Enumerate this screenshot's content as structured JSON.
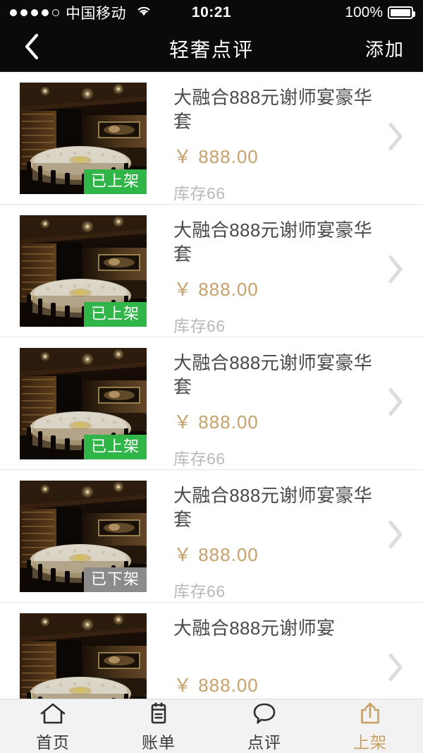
{
  "status_bar": {
    "signal_dots_filled": 4,
    "signal_dots_total": 5,
    "carrier": "中国移动",
    "wifi_icon": "wifi-icon",
    "time": "10:21",
    "battery_percent": "100%",
    "battery_icon": "battery-full-icon"
  },
  "nav": {
    "back_icon": "chevron-left-icon",
    "title": "轻奢点评",
    "action_label": "添加"
  },
  "colors": {
    "nav_background": "#0a0a0a",
    "price_gold": "#c7a06a",
    "accent_gold": "#c7a063",
    "badge_listed": "#2fb548",
    "badge_delisted": "#8b8b8b",
    "page_background": "#ffffff",
    "tabbar_background": "#f2f2f2"
  },
  "list": {
    "chevron_icon": "chevron-right-icon",
    "items": [
      {
        "thumbnail_alt": "restaurant-private-dining-room",
        "badge": "已上架",
        "badge_state": "listed",
        "title": "大融合888元谢师宴豪华套",
        "price": "￥ 888.00",
        "stock": "库存66"
      },
      {
        "thumbnail_alt": "restaurant-private-dining-room",
        "badge": "已上架",
        "badge_state": "listed",
        "title": "大融合888元谢师宴豪华套",
        "price": "￥ 888.00",
        "stock": "库存66"
      },
      {
        "thumbnail_alt": "restaurant-private-dining-room",
        "badge": "已上架",
        "badge_state": "listed",
        "title": "大融合888元谢师宴豪华套",
        "price": "￥ 888.00",
        "stock": "库存66"
      },
      {
        "thumbnail_alt": "restaurant-private-dining-room",
        "badge": "已下架",
        "badge_state": "delisted",
        "title": "大融合888元谢师宴豪华套",
        "price": "￥ 888.00",
        "stock": "库存66"
      },
      {
        "thumbnail_alt": "restaurant-private-dining-room",
        "badge": "",
        "badge_state": "none",
        "title": "大融合888元谢师宴",
        "price": "￥ 888.00",
        "stock": ""
      }
    ]
  },
  "tabbar": {
    "items": [
      {
        "label": "首页",
        "icon": "home-icon",
        "active": false
      },
      {
        "label": "账单",
        "icon": "clipboard-icon",
        "active": false
      },
      {
        "label": "点评",
        "icon": "speech-bubble-icon",
        "active": false
      },
      {
        "label": "上架",
        "icon": "upload-share-icon",
        "active": true
      }
    ]
  }
}
